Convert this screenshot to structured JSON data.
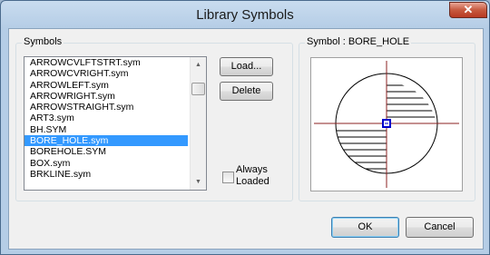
{
  "window": {
    "title": "Library Symbols",
    "close_glyph": "✕"
  },
  "symbols_group": {
    "label": "Symbols"
  },
  "symbol_list": {
    "items": [
      "ARROWCVLFTSTRT.sym",
      "ARROWCVRIGHT.sym",
      "ARROWLEFT.sym",
      "ARROWRIGHT.sym",
      "ARROWSTRAIGHT.sym",
      "ART3.sym",
      "BH.SYM",
      "BORE_HOLE.sym",
      "BOREHOLE.SYM",
      "BOX.sym",
      "BRKLINE.sym"
    ],
    "selected": "BORE_HOLE.sym"
  },
  "buttons": {
    "load": "Load...",
    "delete": "Delete",
    "ok": "OK",
    "cancel": "Cancel"
  },
  "always_loaded": {
    "label_line1": "Always",
    "label_line2": "Loaded",
    "checked": false
  },
  "preview": {
    "label": "Symbol : BORE_HOLE"
  },
  "colors": {
    "selection": "#3399ff",
    "crosshair": "#8b2020",
    "marker": "#0000cc"
  }
}
